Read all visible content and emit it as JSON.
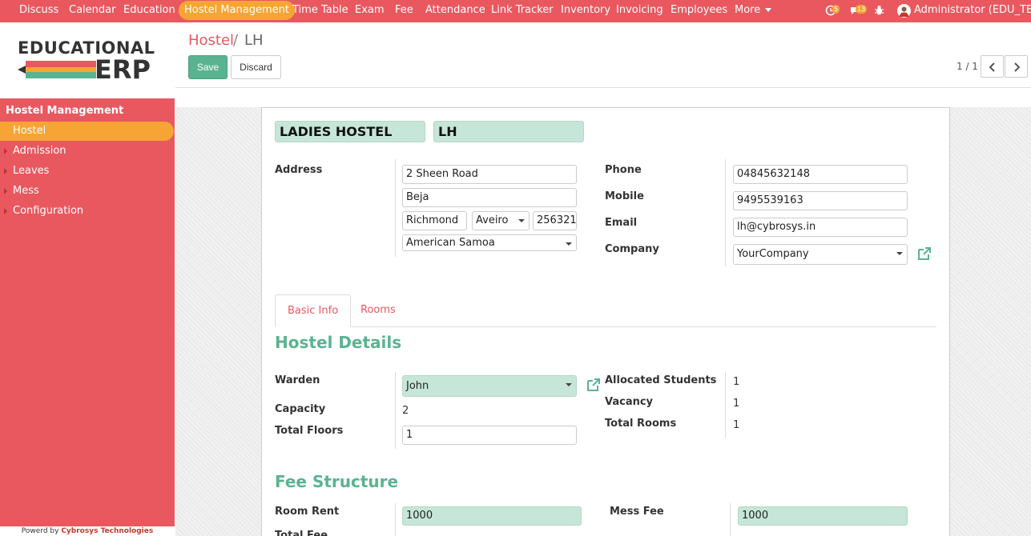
{
  "topbar": {
    "menus": [
      "Discuss",
      "Calendar",
      "Education",
      "Hostel Management",
      "Time Table",
      "Exam",
      "Fee",
      "Attendance",
      "Link Tracker",
      "Inventory",
      "Invoicing",
      "Employees",
      "More"
    ],
    "activity_count": "5",
    "message_count": "13",
    "user": "Administrator (EDU_TE..."
  },
  "logo": {
    "line1": "EDUCATIONAL",
    "line2": "ERP"
  },
  "sidebar": {
    "title": "Hostel Management",
    "items": [
      "Hostel",
      "Admission",
      "Leaves",
      "Mess",
      "Configuration"
    ],
    "powered_prefix": "Powerd by",
    "powered_company": "Cybrosys Technologies"
  },
  "breadcrumb": {
    "parent": "Hostel",
    "sep": "/",
    "current": "LH"
  },
  "buttons": {
    "save": "Save",
    "discard": "Discard"
  },
  "pager": "1 / 1",
  "form": {
    "name": "LADIES HOSTEL",
    "code": "LH",
    "address_label": "Address",
    "street": "2 Sheen Road",
    "street2": "Beja",
    "city": "Richmond",
    "state": "Aveiro",
    "zip": "256321",
    "country": "American Samoa",
    "phone_label": "Phone",
    "phone": "04845632148",
    "mobile_label": "Mobile",
    "mobile": "9495539163",
    "email_label": "Email",
    "email": "lh@cybrosys.in",
    "company_label": "Company",
    "company": "YourCompany"
  },
  "tabs": [
    "Basic Info",
    "Rooms"
  ],
  "hostel_details": {
    "heading": "Hostel Details",
    "warden_label": "Warden",
    "warden": "John",
    "capacity_label": "Capacity",
    "capacity": "2",
    "floors_label": "Total Floors",
    "floors": "1",
    "allocated_label": "Allocated Students",
    "allocated": "1",
    "vacancy_label": "Vacancy",
    "vacancy": "1",
    "rooms_label": "Total Rooms",
    "rooms": "1"
  },
  "fee_structure": {
    "heading": "Fee Structure",
    "room_rent_label": "Room Rent",
    "room_rent": "1000",
    "mess_fee_label": "Mess Fee",
    "mess_fee": "1000",
    "total_label": "Total Fee"
  },
  "colors": {
    "brand": "#e9585f",
    "accent": "#f6a534",
    "green": "#5ab390"
  }
}
